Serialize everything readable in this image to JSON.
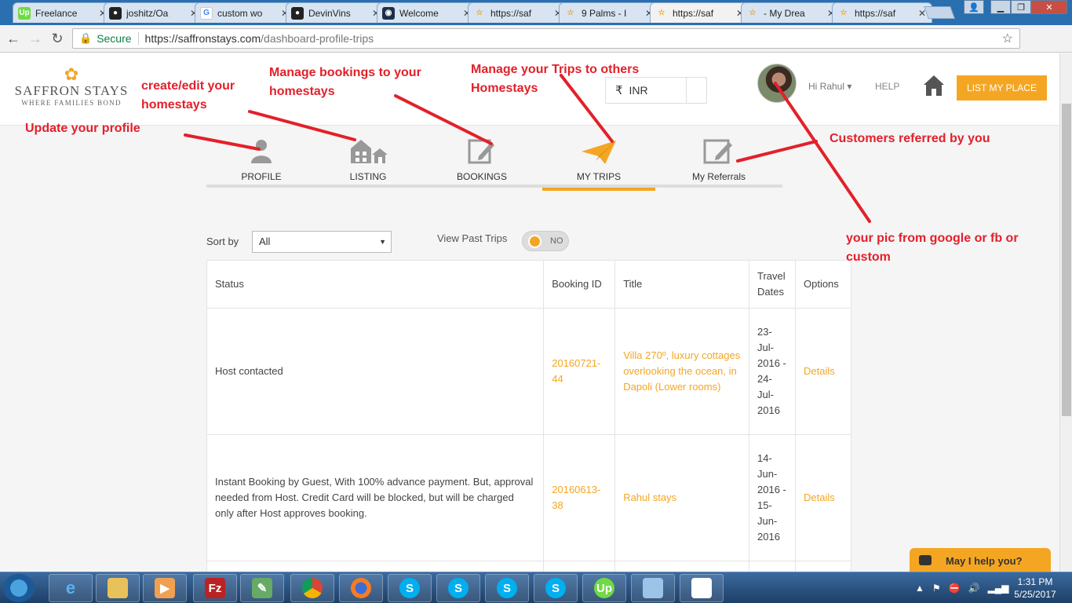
{
  "browser": {
    "tabs": [
      {
        "label": "Freelance",
        "icon": "upwork-icon",
        "color": "#6fda44"
      },
      {
        "label": "joshitz/Oa",
        "icon": "github-icon",
        "color": "#222222"
      },
      {
        "label": "custom wo",
        "icon": "google-icon",
        "color": "#4285f4"
      },
      {
        "label": "DevinVins",
        "icon": "github-icon",
        "color": "#222222"
      },
      {
        "label": "Welcome",
        "icon": "app-icon",
        "color": "#1d2f4a"
      },
      {
        "label": "https://saf",
        "icon": "saffron-icon",
        "color": "#f4a623"
      },
      {
        "label": "9 Palms - I",
        "icon": "saffron-icon",
        "color": "#f4a623"
      },
      {
        "label": "https://saf",
        "icon": "saffron-icon",
        "color": "#f4a623"
      },
      {
        "label": "- My Drea",
        "icon": "saffron-icon",
        "color": "#f4a623"
      },
      {
        "label": "https://saf",
        "icon": "saffron-icon",
        "color": "#f4a623"
      }
    ],
    "active_tab": 7,
    "secure_label": "Secure",
    "url_host": "https://saffronstays.com",
    "url_path": "/dashboard-profile-trips"
  },
  "header": {
    "logo_name": "SAFFRON STAYS",
    "logo_tagline": "WHERE FAMILIES BOND",
    "currency_symbol": "₹",
    "currency": "INR",
    "greeting": "Hi Rahul ▾",
    "help": "HELP",
    "list_button": "LIST MY PLACE",
    "accent": "#f4a623"
  },
  "dashboard_tabs": [
    {
      "label": "PROFILE",
      "icon": "person-icon",
      "active": false
    },
    {
      "label": "LISTING",
      "icon": "houses-icon",
      "active": false
    },
    {
      "label": "BOOKINGS",
      "icon": "edit-icon",
      "active": false
    },
    {
      "label": "MY TRIPS",
      "icon": "paper-plane-icon",
      "active": true
    },
    {
      "label": "My Referrals",
      "icon": "edit-icon",
      "active": false
    }
  ],
  "filters": {
    "sort_label": "Sort by",
    "sort_value": "All",
    "past_trips_label": "View Past Trips",
    "past_trips_toggle": "NO"
  },
  "table": {
    "columns": [
      "Status",
      "Booking ID",
      "Title",
      "Travel Dates",
      "Options"
    ],
    "rows": [
      {
        "status": "Host contacted",
        "booking_id": "20160721-44",
        "title": "Villa 270º, luxury cottages overlooking the ocean, in Dapoli (Lower rooms)",
        "dates": "23-Jul-2016 - 24-Jul-2016",
        "option": "Details"
      },
      {
        "status": "Instant Booking by Guest, With 100% advance payment. But, approval needed from Host. Credit Card will be blocked, but will be charged only after Host approves booking.",
        "booking_id": "20160613-38",
        "title": "Rahul stays",
        "dates": "14-Jun-2016 - 15-Jun-2016",
        "option": "Details"
      }
    ]
  },
  "chat": {
    "label": "May I help you?"
  },
  "annotations": {
    "profile": "Update your profile",
    "listing": "create/edit your homestays",
    "bookings": "Manage bookings to your homestays",
    "trips": "Manage your Trips to others Homestays",
    "referrals": "Customers referred by you",
    "pic": "your pic from google or fb or custom",
    "color": "#e3202a"
  },
  "taskbar": {
    "time": "1:31 PM",
    "date": "5/25/2017"
  }
}
